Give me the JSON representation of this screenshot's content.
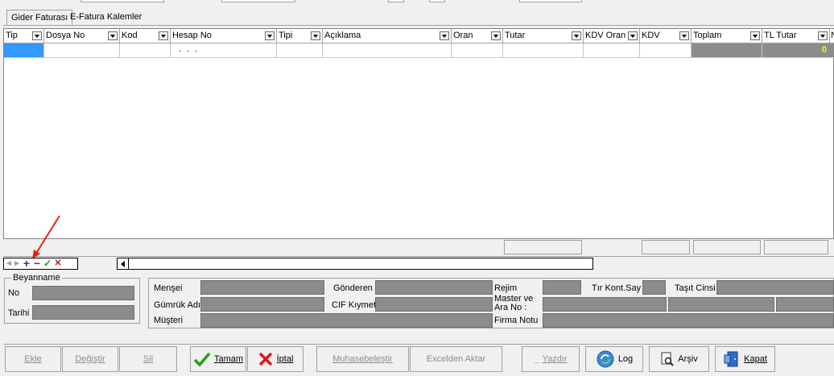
{
  "tabs": [
    "Gider Faturası",
    "E-Fatura Kalemler"
  ],
  "columns": [
    "Tip",
    "Dosya No",
    "Kod",
    "Hesap No",
    "Tipi",
    "Açıklama",
    "Oran",
    "Tutar",
    "KDV Oran",
    "KDV",
    "Toplam",
    "TL Tutar",
    "N"
  ],
  "row": {
    "hesap_no": ". . .",
    "tl_tutar": "0"
  },
  "beyanname": {
    "title": "Beyanname",
    "no_label": "No",
    "tarihi_label": "Tarihi"
  },
  "info": {
    "mensei": "Menşei",
    "gumruk_adi": "Gümrük Adı",
    "musteri": "Müşteri",
    "gonderen": "Gönderen",
    "cif_kiymet": "CIF Kıymet",
    "rejim": "Rejim",
    "master": "Master ve Ara No :",
    "firma_notu": "Firma Notu",
    "tir_kont": "Tır Kont.Say",
    "tasit": "Taşıt Cinsi"
  },
  "buttons": {
    "ekle": "Ekle",
    "degistir": "Değiştir",
    "sil": "Sil",
    "tamam": "Tamam",
    "iptal": "İptal",
    "muhasebe": "Muhasebeleştir",
    "excel": "Excelden Aktar",
    "yazdir": "Yazdır",
    "log": "Log",
    "arsiv": "Arşiv",
    "kapat": "Kapat"
  },
  "colors": {
    "accent": "#3399ff",
    "gray_field": "#8c8c8c",
    "tl_value": "#ffff00"
  }
}
